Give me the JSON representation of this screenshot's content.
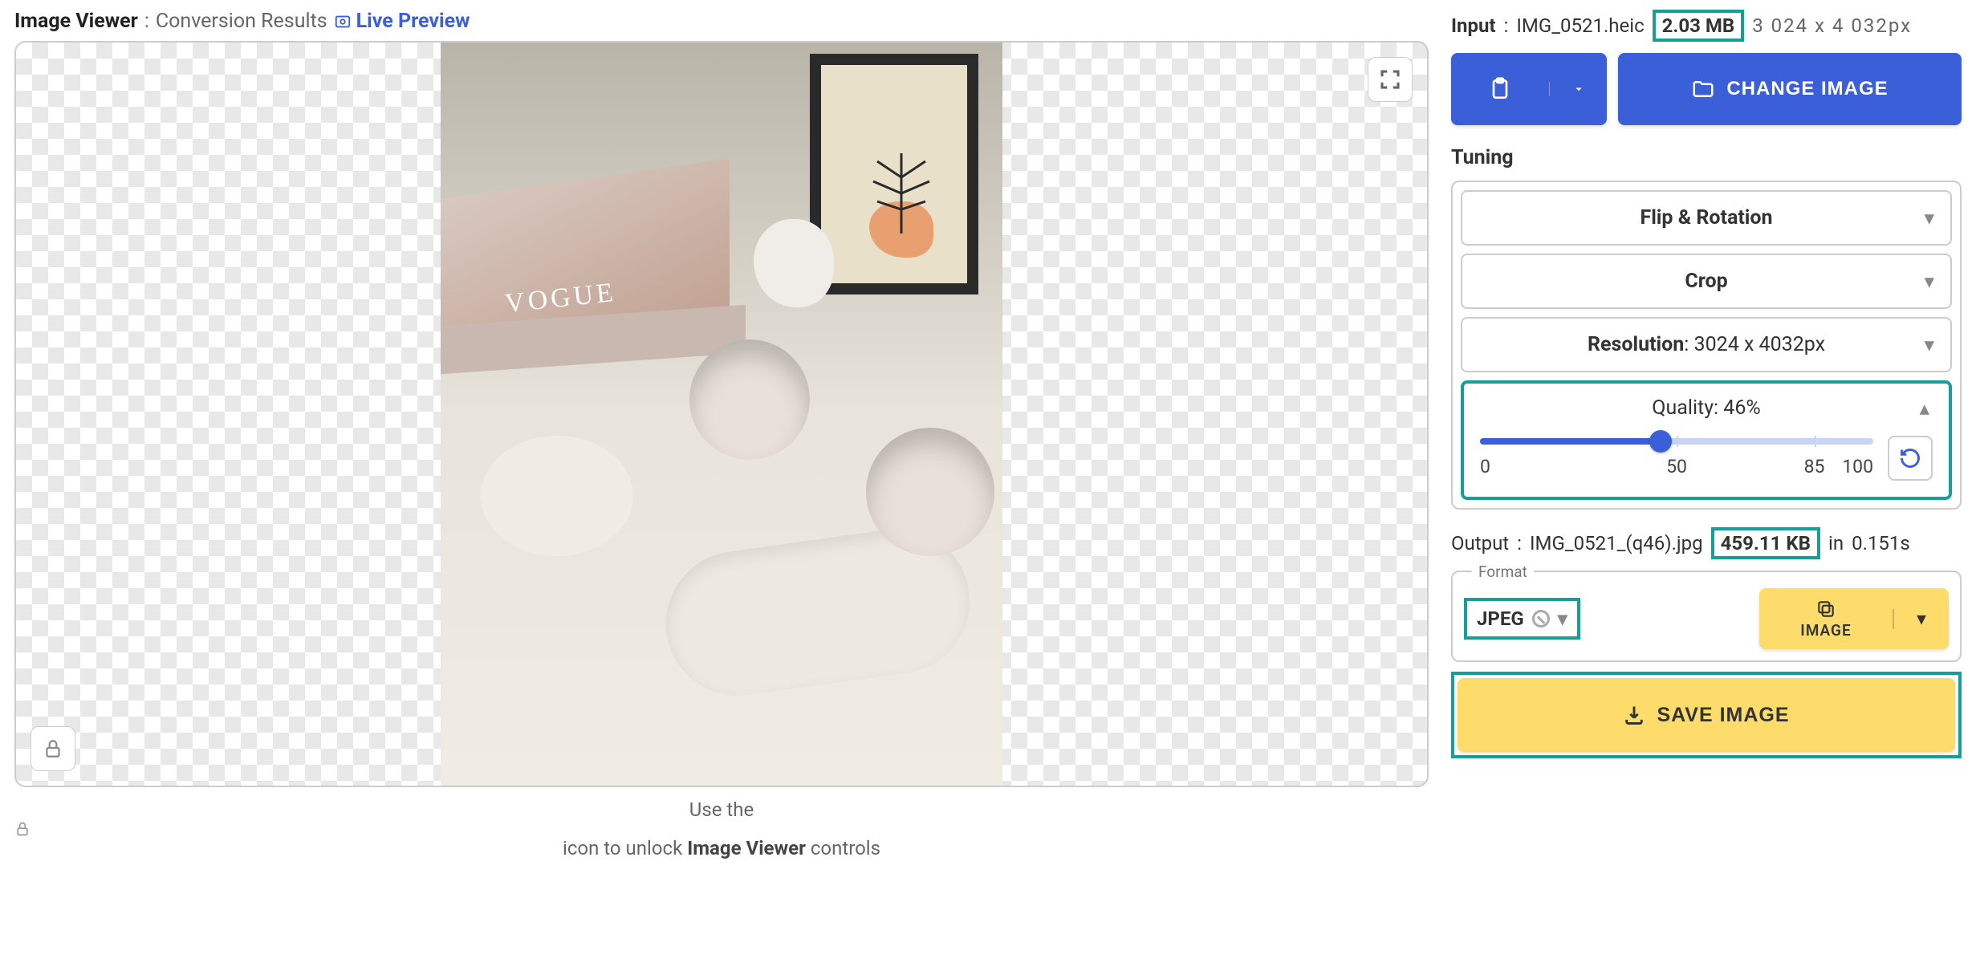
{
  "header": {
    "title": "Image Viewer",
    "subtitle": "Conversion Results",
    "live": "Live Preview"
  },
  "input": {
    "label": "Input",
    "filename": "IMG_0521.heic",
    "size": "2.03 MB",
    "dims": "3 024 x 4 032px"
  },
  "buttons": {
    "change": "CHANGE IMAGE",
    "image": "IMAGE",
    "save": "SAVE IMAGE"
  },
  "tuning": {
    "title": "Tuning",
    "flip": "Flip & Rotation",
    "crop": "Crop",
    "resolution_label": "Resolution",
    "resolution_value": "3024 x 4032px",
    "quality_label": "Quality",
    "quality_value": "46%",
    "slider": {
      "min": "0",
      "mid": "50",
      "hi": "85",
      "max": "100"
    }
  },
  "output": {
    "label": "Output",
    "filename": "IMG_0521_(q46).jpg",
    "size": "459.11 KB",
    "time_prefix": "in",
    "time": "0.151s"
  },
  "format": {
    "legend": "Format",
    "selected": "JPEG"
  },
  "hint": {
    "p1": "Use the",
    "p2": "icon to unlock",
    "p3": "Image Viewer",
    "p4": "controls"
  }
}
